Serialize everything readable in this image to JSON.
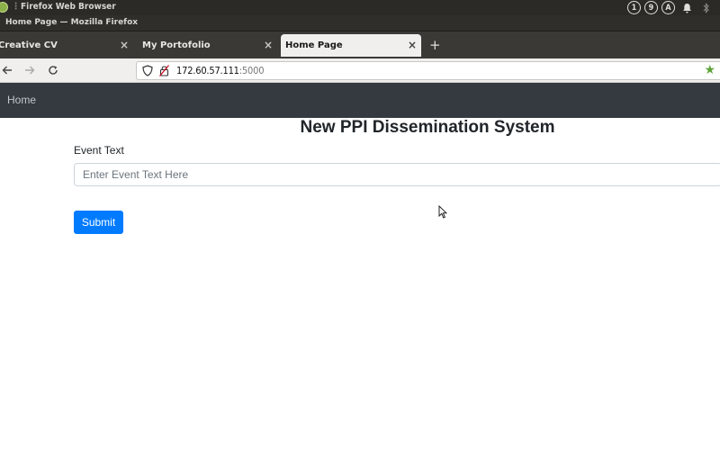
{
  "os_panel": {
    "app_title": "Firefox Web Browser",
    "tray": [
      "1",
      "9",
      "A"
    ]
  },
  "window": {
    "title": "Home Page — Mozilla Firefox"
  },
  "tabs": [
    {
      "label": "Creative CV",
      "active": false
    },
    {
      "label": "My Portofolio",
      "active": false
    },
    {
      "label": "Home Page",
      "active": true
    }
  ],
  "toolbar": {
    "url_host": "172.60.57.111",
    "url_port": ":5000"
  },
  "site": {
    "brand": "Home"
  },
  "page": {
    "title": "New PPI Dissemination System",
    "field_label": "Event Text",
    "field_placeholder": "Enter Event Text Here",
    "field_value": "",
    "submit_label": "Submit"
  },
  "colors": {
    "navbar": "#343a40",
    "primary": "#007bff",
    "bookmark_star": "#5ea43a"
  }
}
